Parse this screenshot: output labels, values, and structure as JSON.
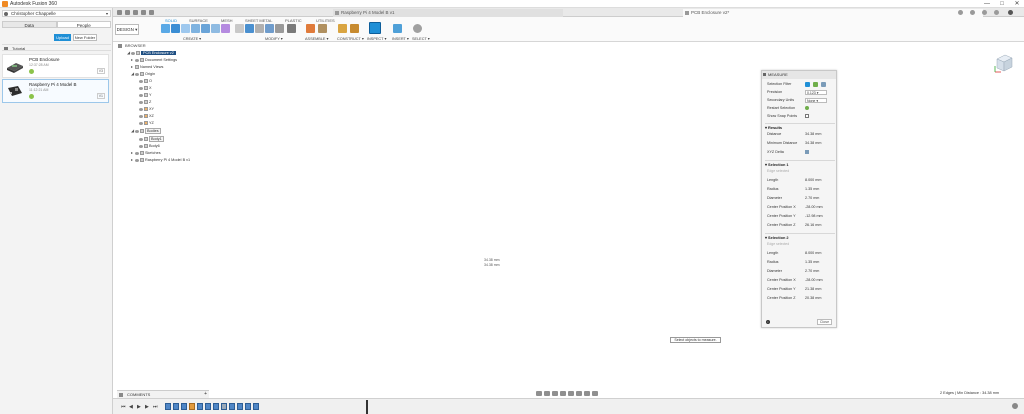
{
  "window": {
    "title": "Autodesk Fusion 360",
    "controls": [
      "—",
      "□",
      "✕"
    ]
  },
  "data_panel": {
    "user": "Christopher Chappelle",
    "tabs": [
      "Data",
      "People"
    ],
    "upload_label": "Upload",
    "new_folder_label": "New Folder",
    "breadcrumb": "Tutorial",
    "files": [
      {
        "name": "PCB Enclosure",
        "date": "12:37:28 AM",
        "version": "V3"
      },
      {
        "name": "Raspberry Pi 4 Model B",
        "date": "11:12:21 AM",
        "version": "V1"
      }
    ]
  },
  "tabs": {
    "inactive_title": "Raspberry Pi 4 Model B v1",
    "active_title": "PCB Enclosure v2*"
  },
  "toolbar": {
    "workspace": "DESIGN",
    "ribbon_tabs": [
      "SOLID",
      "SURFACE",
      "MESH",
      "SHEET METAL",
      "PLASTIC",
      "UTILITIES"
    ],
    "active_ribbon_tab": "SOLID",
    "groups": [
      "CREATE",
      "MODIFY",
      "ASSEMBLE",
      "CONSTRUCT",
      "INSPECT",
      "INSERT",
      "SELECT"
    ]
  },
  "browser": {
    "title": "BROWSER",
    "rows": [
      {
        "label": "PCB Enclosure v2",
        "level": 0,
        "tri": "◢",
        "highlight": true
      },
      {
        "label": "Document Settings",
        "level": 1,
        "tri": "▸"
      },
      {
        "label": "Named Views",
        "level": 1,
        "tri": "▸"
      },
      {
        "label": "Origin",
        "level": 1,
        "tri": "◢"
      },
      {
        "label": "O",
        "level": 2,
        "tri": ""
      },
      {
        "label": "X",
        "level": 2,
        "tri": ""
      },
      {
        "label": "Y",
        "level": 2,
        "tri": ""
      },
      {
        "label": "Z",
        "level": 2,
        "tri": ""
      },
      {
        "label": "XY",
        "level": 2,
        "tri": ""
      },
      {
        "label": "XZ",
        "level": 2,
        "tri": ""
      },
      {
        "label": "YZ",
        "level": 2,
        "tri": ""
      },
      {
        "label": "Bodies",
        "level": 1,
        "tri": "◢",
        "boxed": true
      },
      {
        "label": "Body1",
        "level": 2,
        "tri": "",
        "boxed": true
      },
      {
        "label": "Body6",
        "level": 2,
        "tri": ""
      },
      {
        "label": "Sketches",
        "level": 1,
        "tri": "▸"
      },
      {
        "label": "Raspberry Pi 4 Model B v1",
        "level": 1,
        "tri": "▸"
      }
    ]
  },
  "measure": {
    "title": "MEASURE",
    "selection_filter_label": "Selection Filter",
    "precision_label": "Precision",
    "precision_value": "0.123",
    "secondary_units_label": "Secondary Units",
    "secondary_units_value": "None",
    "restart_selection_label": "Restart Selection",
    "show_snap_points_label": "Show Snap Points",
    "results_title": "Results",
    "results": [
      {
        "label": "Distance",
        "value": "34.38 mm"
      },
      {
        "label": "Minimum Distance",
        "value": "34.38 mm"
      },
      {
        "label": "XYZ Delta",
        "value": ""
      }
    ],
    "selection1_title": "Selection 1",
    "selection1_sub": "Edge selected",
    "selection1": [
      {
        "label": "Length",
        "value": "8.000 mm"
      },
      {
        "label": "Radius",
        "value": "1.35 mm"
      },
      {
        "label": "Diameter",
        "value": "2.70 mm"
      },
      {
        "label": "Center Position X",
        "value": "-28.00 mm"
      },
      {
        "label": "Center Position Y",
        "value": "-12.98 mm"
      },
      {
        "label": "Center Position Z",
        "value": "26.16 mm"
      }
    ],
    "selection2_title": "Selection 2",
    "selection2_sub": "Edge selected",
    "selection2": [
      {
        "label": "Length",
        "value": "8.000 mm"
      },
      {
        "label": "Radius",
        "value": "1.35 mm"
      },
      {
        "label": "Diameter",
        "value": "2.70 mm"
      },
      {
        "label": "Center Position X",
        "value": "-28.00 mm"
      },
      {
        "label": "Center Position Y",
        "value": "21.38 mm"
      },
      {
        "label": "Center Position Z",
        "value": "20.38 mm"
      }
    ],
    "close_label": "Close"
  },
  "canvas": {
    "tooltip": "Select objects to measure.",
    "dim_label_1": "34.38 mm",
    "dim_label_2": "34.38 mm"
  },
  "bottom": {
    "comments_label": "COMMENTS",
    "status": "2 Edges | Min Distance : 34.38 mm"
  },
  "colors": {
    "accent": "#1f8fd6",
    "body_side": "#8a8a85",
    "body_top": "#a09e98",
    "browser_highlight": "#1f4f82"
  }
}
